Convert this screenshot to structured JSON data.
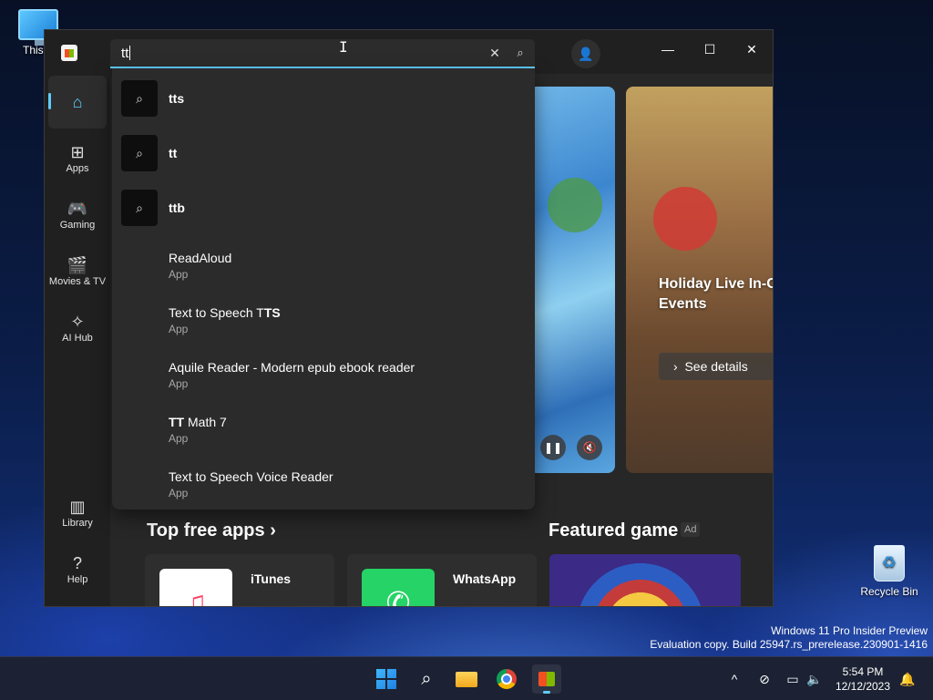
{
  "desktop": {
    "this_pc_label": "This P",
    "recycle_bin_label": "Recycle Bin",
    "watermark_line1": "Windows 11 Pro Insider Preview",
    "watermark_line2": "Evaluation copy. Build 25947.rs_prerelease.230901-1416"
  },
  "window": {
    "minimize_glyph": "—",
    "maximize_glyph": "☐",
    "close_glyph": "✕",
    "account_glyph": "👤"
  },
  "search": {
    "value": "tt",
    "clear_glyph": "✕",
    "search_glyph": "⌕"
  },
  "suggestions": [
    {
      "label": "tts",
      "icon": "search-icon"
    },
    {
      "label": "tt",
      "icon": "search-icon"
    },
    {
      "label": "ttb",
      "icon": "search-icon"
    }
  ],
  "app_results": [
    {
      "bold": "",
      "name": "ReadAloud",
      "type": "App"
    },
    {
      "bold": "",
      "name": "Text to Speech T",
      "bold_tail": "TS",
      "type": "App"
    },
    {
      "bold": "",
      "name": "Aquile Reader - Modern epub ebook reader",
      "type": "App"
    },
    {
      "bold": "TT",
      "name": " Math 7",
      "type": "App"
    },
    {
      "bold": "",
      "name": "Text to Speech Voice Reader",
      "type": "App"
    }
  ],
  "sidebar": {
    "items": [
      {
        "label": "",
        "icon": "home-icon",
        "glyph": "⌂"
      },
      {
        "label": "Apps",
        "icon": "apps-icon",
        "glyph": "⊞"
      },
      {
        "label": "Gaming",
        "icon": "gamepad-icon",
        "glyph": "🎮"
      },
      {
        "label": "Movies & TV",
        "icon": "clapperboard-icon",
        "glyph": "🎬"
      },
      {
        "label": "AI Hub",
        "icon": "sparkle-icon",
        "glyph": "✧"
      },
      {
        "label": "Library",
        "icon": "library-icon",
        "glyph": "▥"
      },
      {
        "label": "Help",
        "icon": "help-icon",
        "glyph": "?"
      }
    ]
  },
  "hero": {
    "title": "Holiday Live In-G Events",
    "see_details": "See details",
    "pause_glyph": "❚❚",
    "mute_glyph": "🔇"
  },
  "sections": {
    "top_free_apps": "Top free apps ›",
    "featured_game": "Featured game",
    "ad_badge": "Ad"
  },
  "cards": [
    {
      "name": "iTunes"
    },
    {
      "name": "WhatsApp"
    }
  ],
  "taskbar": {
    "time": "5:54 PM",
    "date": "12/12/2023",
    "chevron_glyph": "^",
    "search_glyph": "⌕",
    "network_glyph": "⊘",
    "display_glyph": "▭",
    "volume_glyph": "🔈",
    "bell_glyph": "🔔"
  },
  "colors": {
    "accent": "#60cdff",
    "window_bg": "#202020",
    "dropdown_bg": "#2b2b2b"
  }
}
